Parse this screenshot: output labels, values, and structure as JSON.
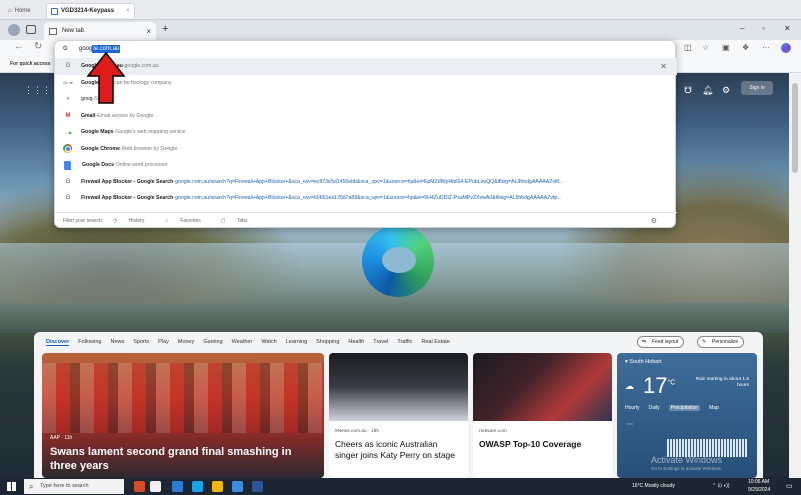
{
  "outer_tabs": [
    {
      "label": "Home"
    },
    {
      "label": "VGD3214-Keypass"
    }
  ],
  "browser": {
    "tab_label": "New tab",
    "window_controls": [
      "–",
      "▫",
      "✕"
    ]
  },
  "omnibox": {
    "typed": "goog",
    "autocomplete": "le.com.au"
  },
  "favorites_bar": {
    "text": "For quick access"
  },
  "suggestions": [
    {
      "icon": "google-g-icon",
      "bold": "Google",
      "rest": "le.com.au",
      "sep": " - ",
      "desc": "google.com.au",
      "close": "✕"
    },
    {
      "icon": "google-logo-icon",
      "bold": "Google",
      "rest": "",
      "sep": " - ",
      "desc": "American technology company"
    },
    {
      "icon": "search-icon",
      "bold": "goog",
      "rest": "",
      "sep": " - ",
      "desc": "Search"
    },
    {
      "icon": "gmail-icon",
      "bold": "Gmail",
      "rest": "",
      "sep": " - ",
      "desc": "Email service by Google"
    },
    {
      "icon": "maps-icon",
      "bold": "Google Maps",
      "rest": "",
      "sep": " - ",
      "desc": "Google's web mapping service"
    },
    {
      "icon": "chrome-icon",
      "bold": "Google Chrome",
      "rest": "",
      "sep": " - ",
      "desc": "Web browser by Google"
    },
    {
      "icon": "docs-icon",
      "bold": "Google Docs",
      "rest": "",
      "sep": " - ",
      "desc": "Online word processor"
    },
    {
      "icon": "google-g-icon",
      "bold": "Firewall App Blocker - Google Search",
      "rest": "",
      "sep": " - ",
      "desc": "google.com.au/search?q=Firewall+App+Blocker+&sca_esv=ec873e5d1455ebb&sca_upv=1&source=hp&ei=EpMZdWpHbiG4-EPubLouQQ&iflsig=AL9hbdgAAAAAZvl8..."
    },
    {
      "icon": "google-g-icon",
      "bold": "Firewall App Blocker - Google Search",
      "rest": "",
      "sep": " - ",
      "desc": "google.com.au/search?q=Firewall+App+Blocker+&sca_esv=b0b51ea178d7a89&sca_upv=1&source=hp&ei=5H4ZuDDIZ-PsaMPvZXvwA0&iflsig=AL9hbdgAAAAAZvfp..."
    }
  ],
  "filter_bar": {
    "label": "Filter your search:",
    "history": "History",
    "favorites": "Favorites",
    "tabs": "Tabs"
  },
  "page": {
    "signin": "Sign in"
  },
  "feed": {
    "nav": [
      "Discover",
      "Following",
      "News",
      "Sports",
      "Play",
      "Money",
      "Gaming",
      "Weather",
      "Watch",
      "Learning",
      "Shopping",
      "Health",
      "Travel",
      "Traffic",
      "Real Estate"
    ],
    "feed_layout": "Feed layout",
    "personalize": "Personalize",
    "cards": [
      {
        "source": "AAP · 11h",
        "title": "Swans lament second grand final smashing in three years"
      },
      {
        "source": "9News.com.au · 18h",
        "title": "Cheers as iconic Australian singer joins Katy Perry on stage"
      },
      {
        "source": "redware.com",
        "title": "OWASP Top-10 Coverage"
      }
    ],
    "weather": {
      "location": "South Hobart",
      "temp": "17",
      "unit": "°C",
      "rain_note": "Rain starting in about 1.5 hours",
      "tabs": [
        "Hourly",
        "Daily",
        "Precipitation",
        "Map"
      ],
      "activate_title": "Activate Windows",
      "activate_sub": "Go to Settings to activate Windows.",
      "bottom_times": "11 AM   12 PM   1 PM   2 PM"
    }
  },
  "taskbar": {
    "search_placeholder": "Type here to search",
    "weather": "16°C  Mostly cloudy",
    "time": "10:06 AM",
    "date": "9/29/2024"
  },
  "colors": {
    "accent": "#1c68d6",
    "annotation_arrow": "#e01b1b"
  }
}
